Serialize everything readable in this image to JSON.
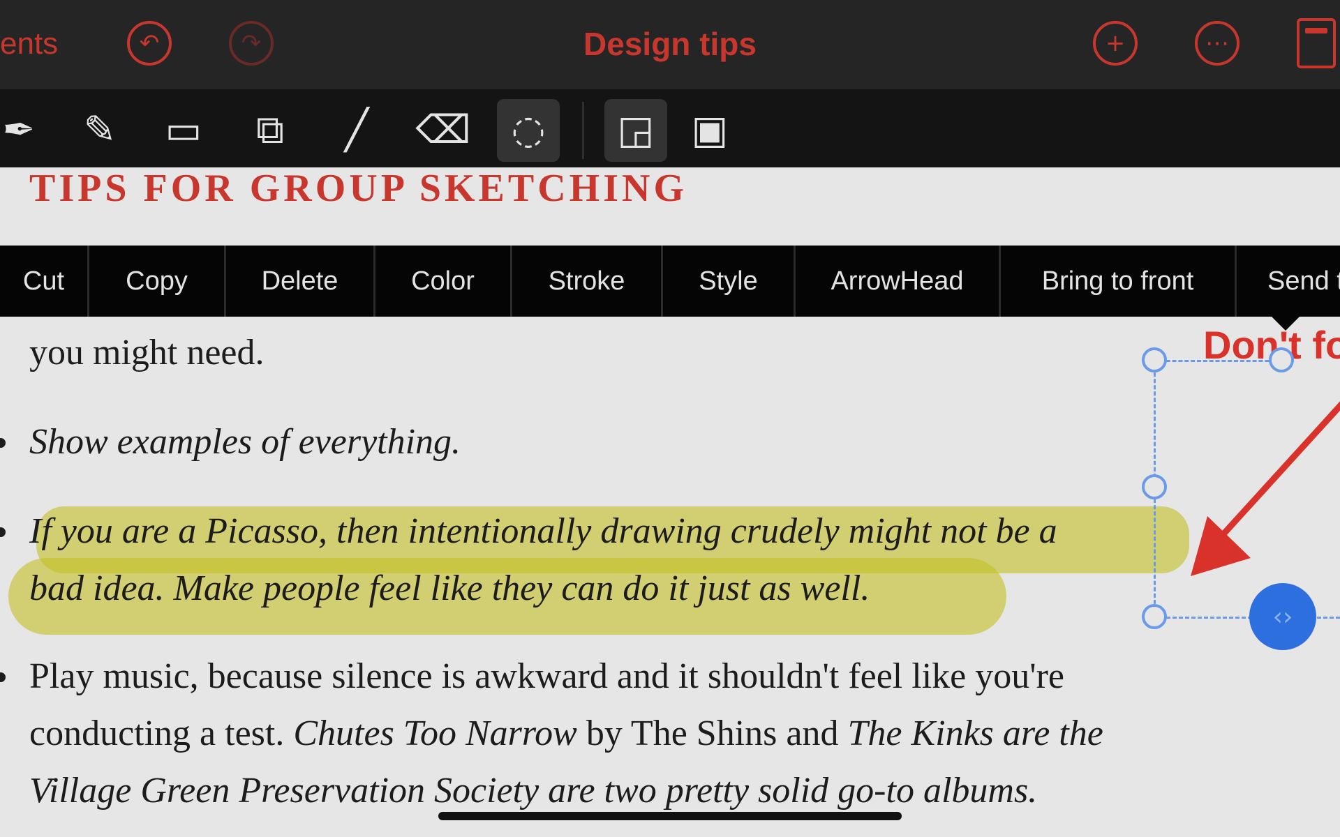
{
  "header": {
    "back_label": "ents",
    "title": "Design tips"
  },
  "context_menu": {
    "items": [
      "Cut",
      "Copy",
      "Delete",
      "Color",
      "Stroke",
      "Style",
      "ArrowHead",
      "Bring to front",
      "Send t"
    ]
  },
  "document": {
    "heading": "TIPS FOR GROUP SKETCHING",
    "line1": "you might need.",
    "line2": "Show examples of everything.",
    "line3": "If you are a Picasso, then intentionally drawing crudely might not be a",
    "line4": "bad idea. Make people feel like they can do it just as well.",
    "line5": "Play music, because silence is awkward and it shouldn't feel like you're",
    "line6_a": "conducting a test. ",
    "line6_b": "Chutes Too Narrow",
    "line6_c": " by The Shins and ",
    "line6_d": "The Kinks are the",
    "line7_a": "Village Green Preservation Society",
    "line7_b": " are two pretty solid go-to albums."
  },
  "annotation": {
    "text": "Don't fo"
  },
  "colors": {
    "accent": "#c8372e",
    "highlight": "#c4c028",
    "selection": "#2e6fe0",
    "arrow": "#d9322a"
  }
}
